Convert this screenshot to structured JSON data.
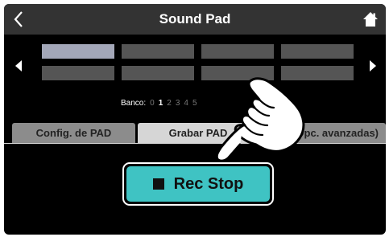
{
  "header": {
    "title": "Sound Pad",
    "back_icon": "chevron-left-icon",
    "home_icon": "home-icon"
  },
  "pads": {
    "left_arrow_icon": "triangle-left-icon",
    "right_arrow_icon": "triangle-right-icon",
    "count": 8,
    "selected_index": 0
  },
  "bank": {
    "label": "Banco:",
    "numbers": [
      "0",
      "1",
      "2",
      "3",
      "4",
      "5"
    ],
    "active": "1"
  },
  "tabs": [
    {
      "label": "Config. de PAD"
    },
    {
      "label": "Grabar PAD"
    },
    {
      "label": "PAD (Opc. avanzadas)"
    }
  ],
  "rec_button": {
    "label": "Rec Stop",
    "icon": "stop-square-icon"
  },
  "overlay": {
    "icon": "pointing-hand-icon"
  },
  "colors": {
    "accent": "#3fc3c3",
    "title_bar": "#333333",
    "pad": "#555555",
    "pad_selected": "#a3a7b8",
    "tab_active": "#d6d6d6",
    "tab_inactive": "#8c8c8c"
  }
}
